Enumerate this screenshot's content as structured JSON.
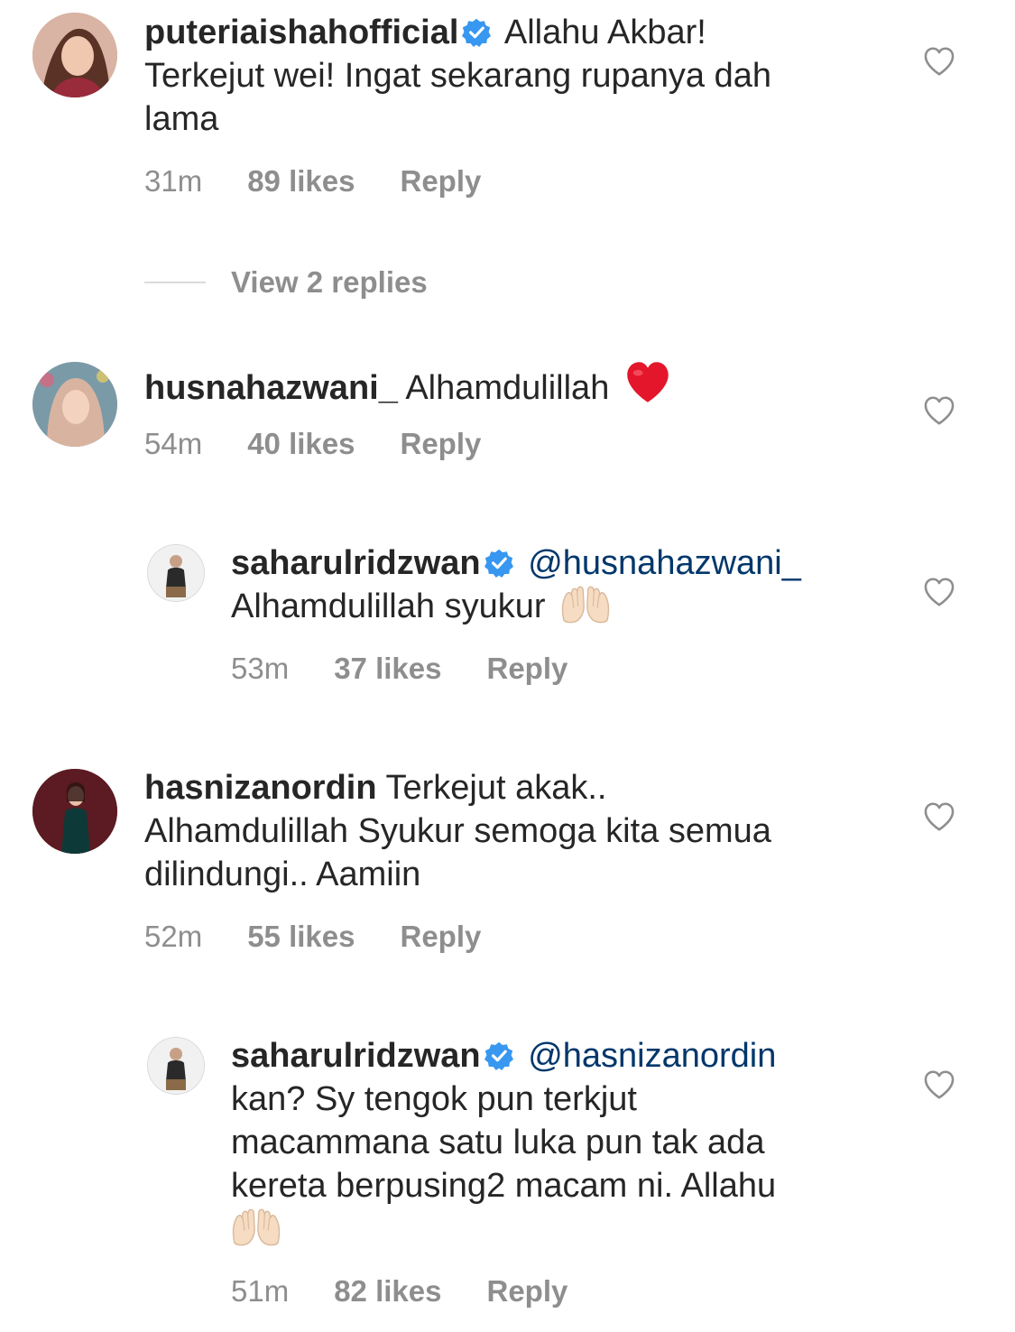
{
  "comments": [
    {
      "username": "puteriaishahofficial",
      "verified": true,
      "text_lines": [
        "Allahu Akbar!",
        "Terkejut wei! Ingat sekarang rupanya dah",
        "lama"
      ],
      "time": "31m",
      "likes": "89 likes",
      "reply": "Reply"
    },
    {
      "username": "husnahazwani_",
      "verified": false,
      "text": "Alhamdulillah",
      "emoji": "red-heart",
      "time": "54m",
      "likes": "40 likes",
      "reply": "Reply"
    },
    {
      "username": "saharulridzwan",
      "verified": true,
      "mention": "@husnahazwani_",
      "text_lines": [
        "Alhamdulillah syukur"
      ],
      "emoji": "raised-hands",
      "time": "53m",
      "likes": "37 likes",
      "reply": "Reply"
    },
    {
      "username": "hasnizanordin",
      "verified": false,
      "text_lines": [
        "Terkejut akak..",
        "Alhamdulillah Syukur semoga kita semua",
        "dilindungi.. Aamiin"
      ],
      "time": "52m",
      "likes": "55 likes",
      "reply": "Reply"
    },
    {
      "username": "saharulridzwan",
      "verified": true,
      "mention": "@hasnizanordin",
      "text_lines": [
        "kan? Sy tengok pun terkjut",
        "macammana satu luka pun tak ada",
        "kereta berpusing2 macam ni. Allahu"
      ],
      "emoji": "raised-hands",
      "time": "51m",
      "likes": "82 likes",
      "reply": "Reply"
    }
  ],
  "view_replies_label": "View 2 replies",
  "colors": {
    "text": "#262626",
    "meta": "#8e8e8e",
    "mention": "#00376b",
    "verified": "#3897f0"
  }
}
